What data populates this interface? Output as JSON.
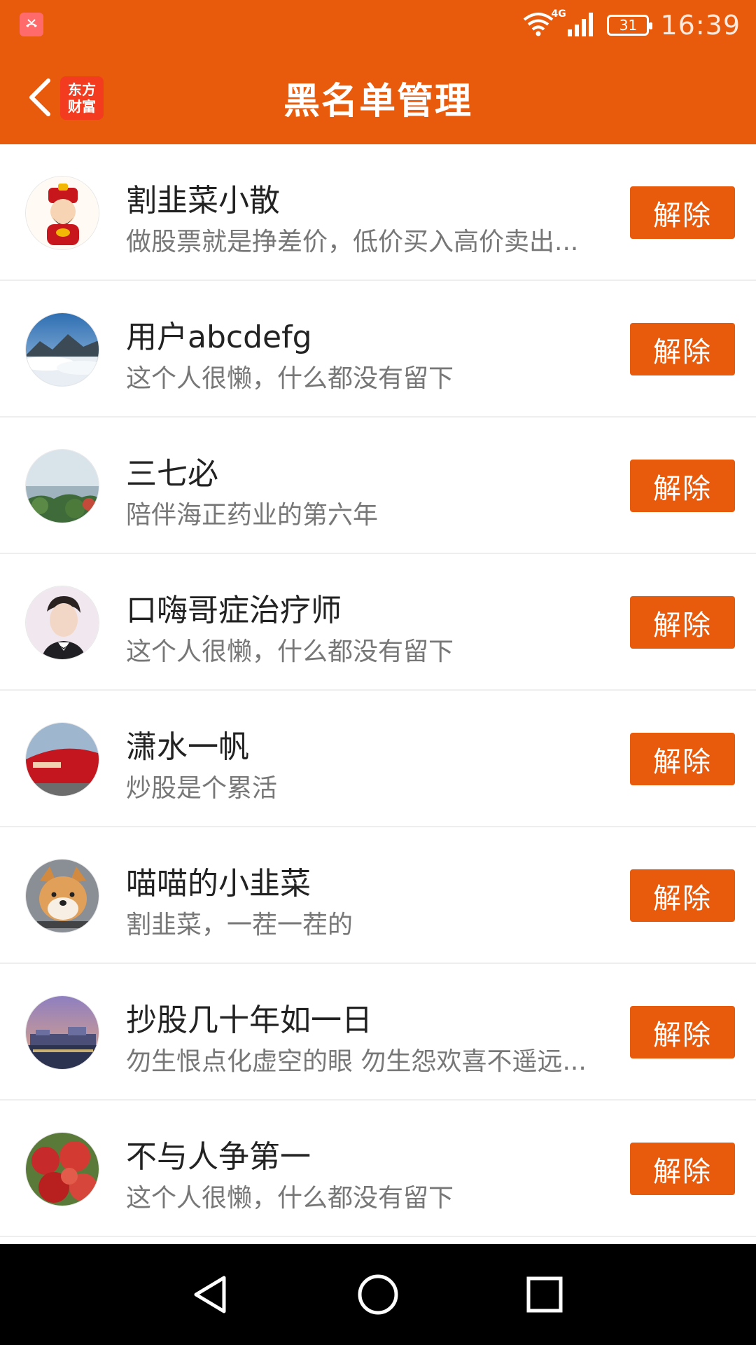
{
  "status_bar": {
    "time": "16:39",
    "battery": "31",
    "network": "4G"
  },
  "header": {
    "title": "黑名单管理",
    "logo_line1": "东方",
    "logo_line2": "财富"
  },
  "colors": {
    "accent": "#E85A0C",
    "divider": "#eeeeee",
    "name_text": "#222222",
    "sig_text": "#777777"
  },
  "list": [
    {
      "name": "割韭菜小散",
      "signature": "做股票就是挣差价，低价买入高价卖出...",
      "action": "解除",
      "avatar": "cartoon-god-of-wealth"
    },
    {
      "name": "用户abcdefg",
      "signature": "这个人很懒，什么都没有留下",
      "action": "解除",
      "avatar": "mountain-clouds"
    },
    {
      "name": "三七必",
      "signature": "陪伴海正药业的第六年",
      "action": "解除",
      "avatar": "lake-trees"
    },
    {
      "name": "口嗨哥症治疗师",
      "signature": "这个人很懒，什么都没有留下",
      "action": "解除",
      "avatar": "young-man-portrait"
    },
    {
      "name": "潇水一帆",
      "signature": "炒股是个累活",
      "action": "解除",
      "avatar": "red-memorial-sign"
    },
    {
      "name": "喵喵的小韭菜",
      "signature": "割韭菜，一茬一茬的",
      "action": "解除",
      "avatar": "shiba-dog"
    },
    {
      "name": "抄股几十年如一日",
      "signature": "勿生恨点化虚空的眼 勿生怨欢喜不遥远...",
      "action": "解除",
      "avatar": "city-night"
    },
    {
      "name": "不与人争第一",
      "signature": "这个人很懒，什么都没有留下",
      "action": "解除",
      "avatar": "red-apples"
    }
  ],
  "nav": {
    "icons": [
      "back-triangle-icon",
      "home-circle-icon",
      "recents-square-icon"
    ]
  }
}
